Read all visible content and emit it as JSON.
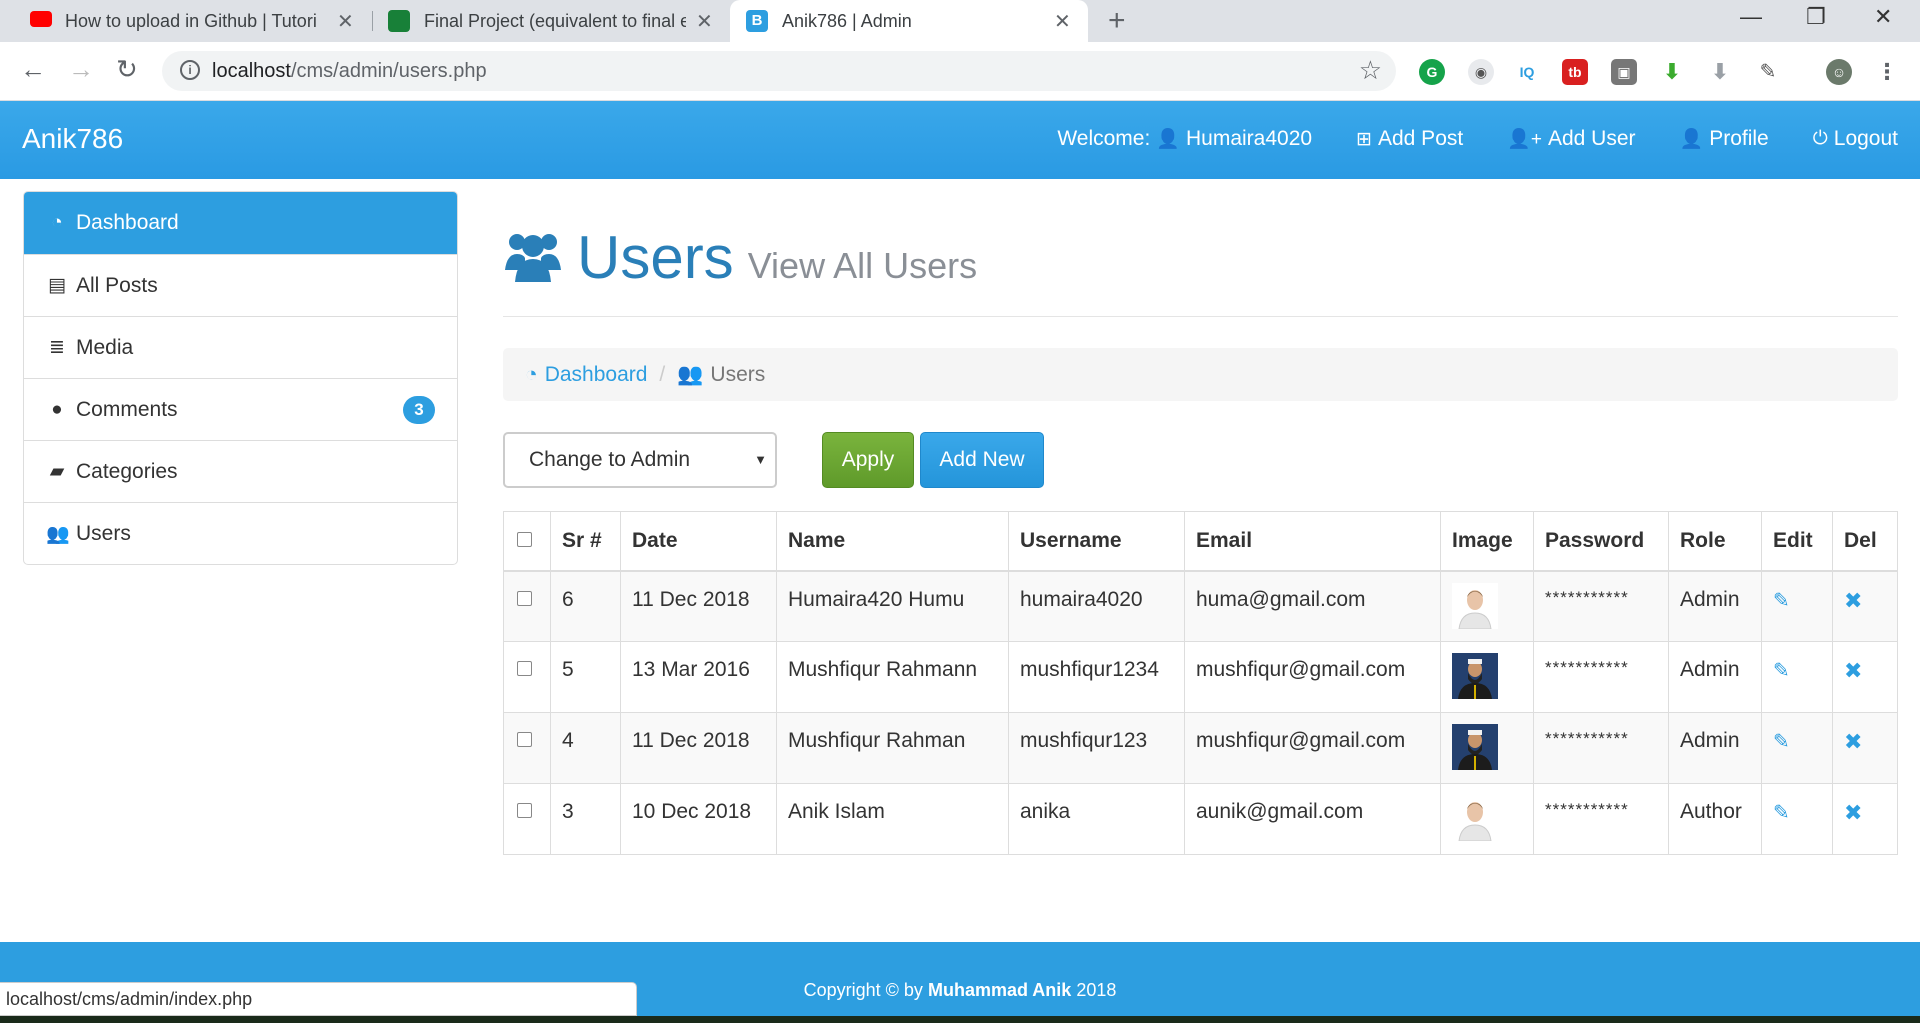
{
  "browser": {
    "tabs": [
      {
        "title": "How to upload in Github | Tutori",
        "favicon_color": "#ff0000"
      },
      {
        "title": "Final Project (equivalent to final e",
        "favicon_color": "#188038"
      },
      {
        "title": "Anik786 | Admin",
        "favicon_color": "#2d9ee0",
        "favicon_letter": "B"
      }
    ],
    "new_tab": "+",
    "url_host": "localhost",
    "url_path": "/cms/admin/users.php",
    "status_url": "localhost/cms/admin/index.php"
  },
  "app": {
    "brand": "Anik786",
    "nav": {
      "welcome": "Welcome:",
      "username": "Humaira4020",
      "add_post": "Add Post",
      "add_user": "Add User",
      "profile": "Profile",
      "logout": "Logout"
    }
  },
  "sidebar": {
    "items": [
      {
        "label": "Dashboard",
        "icon": "dashboard-icon",
        "active": true
      },
      {
        "label": "All Posts",
        "icon": "file-icon"
      },
      {
        "label": "Media",
        "icon": "database-icon"
      },
      {
        "label": "Comments",
        "icon": "comment-icon",
        "badge": "3"
      },
      {
        "label": "Categories",
        "icon": "folder-open-icon"
      },
      {
        "label": "Users",
        "icon": "users-icon"
      }
    ]
  },
  "page": {
    "title": "Users",
    "subtitle": "View All Users",
    "breadcrumb": {
      "home": "Dashboard",
      "current": "Users"
    },
    "bulk_select": "Change to Admin",
    "apply_label": "Apply",
    "add_new_label": "Add New"
  },
  "table": {
    "headers": [
      "Sr #",
      "Date",
      "Name",
      "Username",
      "Email",
      "Image",
      "Password",
      "Role",
      "Edit",
      "Del"
    ],
    "rows": [
      {
        "sr": "6",
        "date": "11 Dec 2018",
        "name": "Humaira420 Humu",
        "username": "humaira4020",
        "email": "huma@gmail.com",
        "image": "default-avatar",
        "password": "***********",
        "role": "Admin"
      },
      {
        "sr": "5",
        "date": "13 Mar 2016",
        "name": "Mushfiqur Rahmann",
        "username": "mushfiqur1234",
        "email": "mushfiqur@gmail.com",
        "image": "photo-avatar",
        "password": "***********",
        "role": "Admin"
      },
      {
        "sr": "4",
        "date": "11 Dec 2018",
        "name": "Mushfiqur Rahman",
        "username": "mushfiqur123",
        "email": "mushfiqur@gmail.com",
        "image": "photo-avatar",
        "password": "***********",
        "role": "Admin"
      },
      {
        "sr": "3",
        "date": "10 Dec 2018",
        "name": "Anik Islam",
        "username": "anika",
        "email": "aunik@gmail.com",
        "image": "default-avatar",
        "password": "***********",
        "role": "Author"
      }
    ]
  },
  "footer": {
    "prefix": "Copyright © by",
    "author": "Muhammad Anik",
    "year": "2018"
  },
  "colors": {
    "primary": "#2d9ee0",
    "title": "#2a7fb8",
    "apply": "#6aa533"
  }
}
